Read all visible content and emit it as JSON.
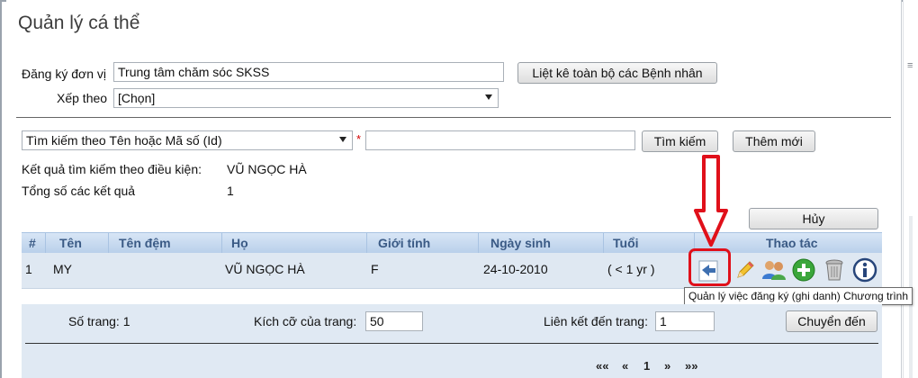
{
  "page": {
    "title": "Quản lý cá thể"
  },
  "filters": {
    "register_unit_label": "Đăng ký đơn vị",
    "register_unit_value": "Trung tâm chăm sóc SKSS",
    "list_all_button": "Liệt kê toàn bộ các Bệnh nhân",
    "sort_label": "Xếp theo",
    "sort_value": "[Chọn]"
  },
  "search": {
    "mode_value": "Tìm kiếm theo Tên hoặc Mã số (Id)",
    "required_mark": "*",
    "query_value": "",
    "search_button": "Tìm kiếm",
    "add_button": "Thêm mới"
  },
  "results": {
    "criteria_label": "Kết quả tìm kiếm theo điều kiện:",
    "criteria_value": "VŨ NGỌC HÀ",
    "total_label": "Tổng số các kết quả",
    "total_value": "1",
    "cancel_button": "Hủy"
  },
  "table": {
    "columns": [
      "#",
      "Tên",
      "Tên đệm",
      "Họ",
      "Giới tính",
      "Ngày sinh",
      "Tuổi",
      "Thao tác"
    ],
    "rows": [
      {
        "index": "1",
        "first_name": "MY",
        "middle_name": "",
        "last_name": "VŨ NGỌC HÀ",
        "gender": "F",
        "dob": "24-10-2010",
        "age": "( < 1 yr )"
      }
    ],
    "actions": [
      "enroll-program-icon",
      "edit-pencil-icon",
      "relationship-users-icon",
      "add-green-icon",
      "delete-trash-icon",
      "info-icon"
    ],
    "tooltip": "Quản lý việc đăng ký (ghi danh) Chương trình"
  },
  "pager": {
    "page_count_label": "Số trang: 1",
    "page_size_label": "Kích cỡ của trang:",
    "page_size_value": "50",
    "jump_label": "Liên kết đến trang:",
    "jump_value": "1",
    "go_button": "Chuyển đến",
    "first": "««",
    "prev": "«",
    "current": "1",
    "next": "»",
    "last": "»»"
  },
  "colors": {
    "grid_header": "#c6d9ef",
    "grid_header_text": "#3a5a85",
    "row_bg": "#dfe8f2",
    "highlight_red": "#e0101a"
  }
}
